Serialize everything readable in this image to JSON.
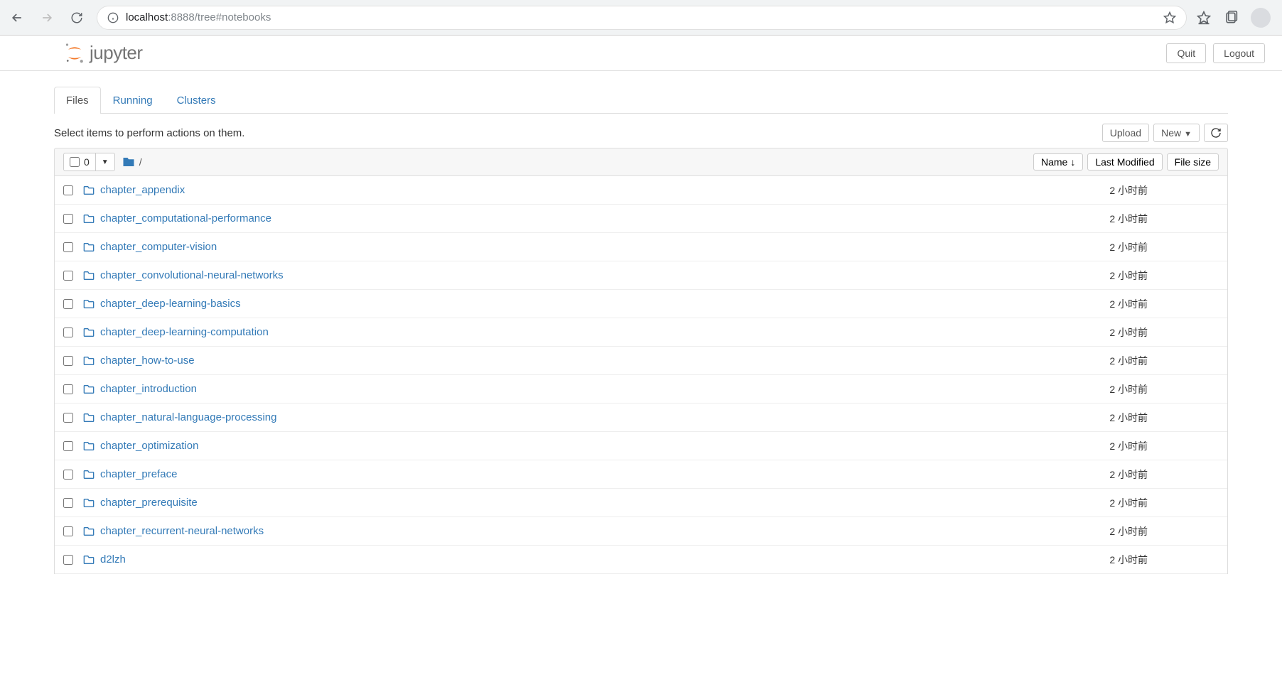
{
  "browser": {
    "url_host": "localhost",
    "url_port": ":8888",
    "url_path": "/tree#notebooks"
  },
  "header": {
    "logo_text": "jupyter",
    "quit": "Quit",
    "logout": "Logout"
  },
  "tabs": {
    "files": "Files",
    "running": "Running",
    "clusters": "Clusters"
  },
  "toolbar": {
    "hint": "Select items to perform actions on them.",
    "upload": "Upload",
    "new": "New"
  },
  "list_header": {
    "select_count": "0",
    "breadcrumb_root": "/",
    "col_name": "Name",
    "col_modified": "Last Modified",
    "col_size": "File size"
  },
  "files": [
    {
      "name": "chapter_appendix",
      "modified": "2 小时前",
      "size": ""
    },
    {
      "name": "chapter_computational-performance",
      "modified": "2 小时前",
      "size": ""
    },
    {
      "name": "chapter_computer-vision",
      "modified": "2 小时前",
      "size": ""
    },
    {
      "name": "chapter_convolutional-neural-networks",
      "modified": "2 小时前",
      "size": ""
    },
    {
      "name": "chapter_deep-learning-basics",
      "modified": "2 小时前",
      "size": ""
    },
    {
      "name": "chapter_deep-learning-computation",
      "modified": "2 小时前",
      "size": ""
    },
    {
      "name": "chapter_how-to-use",
      "modified": "2 小时前",
      "size": ""
    },
    {
      "name": "chapter_introduction",
      "modified": "2 小时前",
      "size": ""
    },
    {
      "name": "chapter_natural-language-processing",
      "modified": "2 小时前",
      "size": ""
    },
    {
      "name": "chapter_optimization",
      "modified": "2 小时前",
      "size": ""
    },
    {
      "name": "chapter_preface",
      "modified": "2 小时前",
      "size": ""
    },
    {
      "name": "chapter_prerequisite",
      "modified": "2 小时前",
      "size": ""
    },
    {
      "name": "chapter_recurrent-neural-networks",
      "modified": "2 小时前",
      "size": ""
    },
    {
      "name": "d2lzh",
      "modified": "2 小时前",
      "size": ""
    }
  ]
}
